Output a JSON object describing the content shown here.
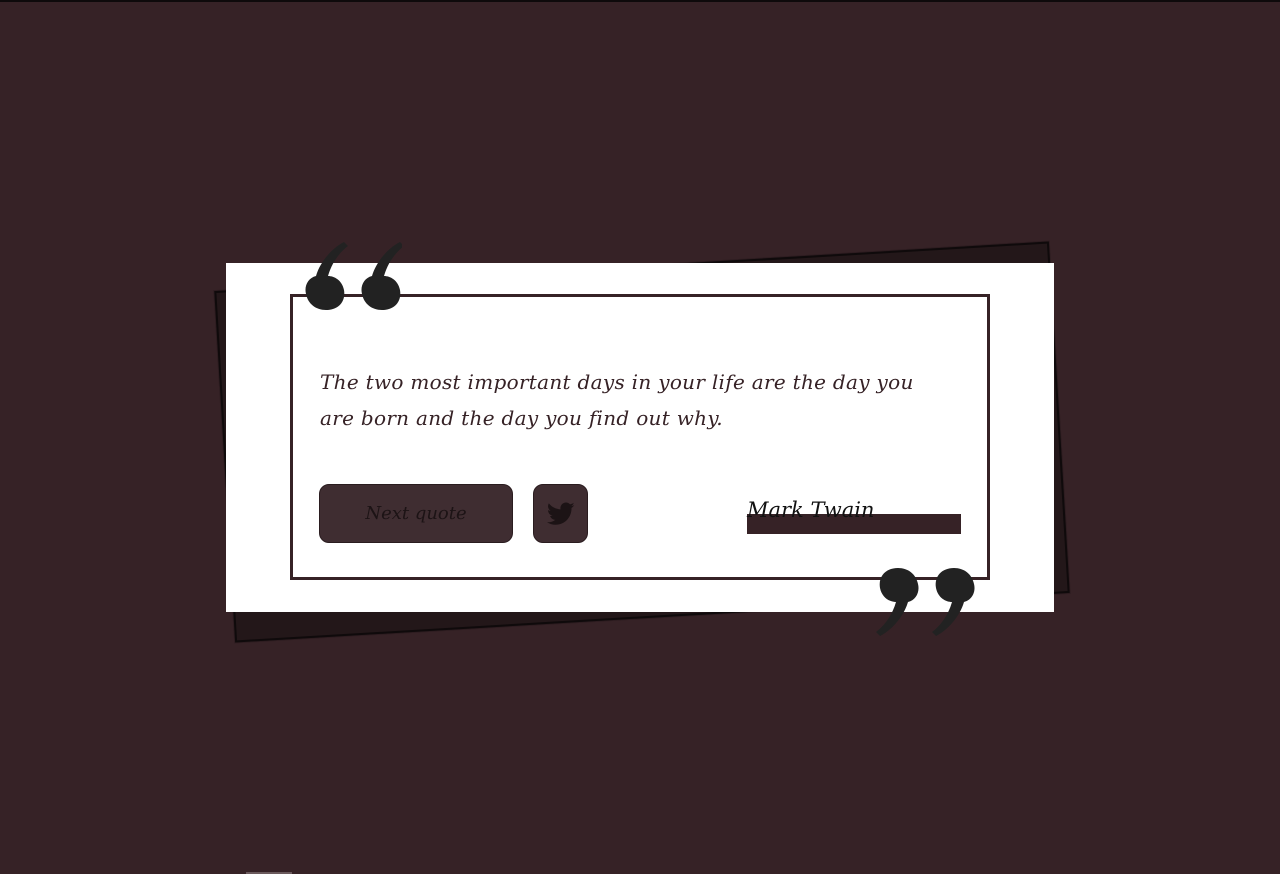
{
  "quote": {
    "text": "The two most important days in your life are the day you are born and the day you find out why.",
    "author": "Mark Twain"
  },
  "actions": {
    "next_label": "Next quote",
    "tweet_icon": "twitter-icon"
  },
  "decor": {
    "open_quote_icon": "open-quote-icon",
    "close_quote_icon": "close-quote-icon"
  },
  "colors": {
    "background": "#362226",
    "card": "#ffffff",
    "button": "#3f2d31",
    "quote_marks": "#222222"
  }
}
